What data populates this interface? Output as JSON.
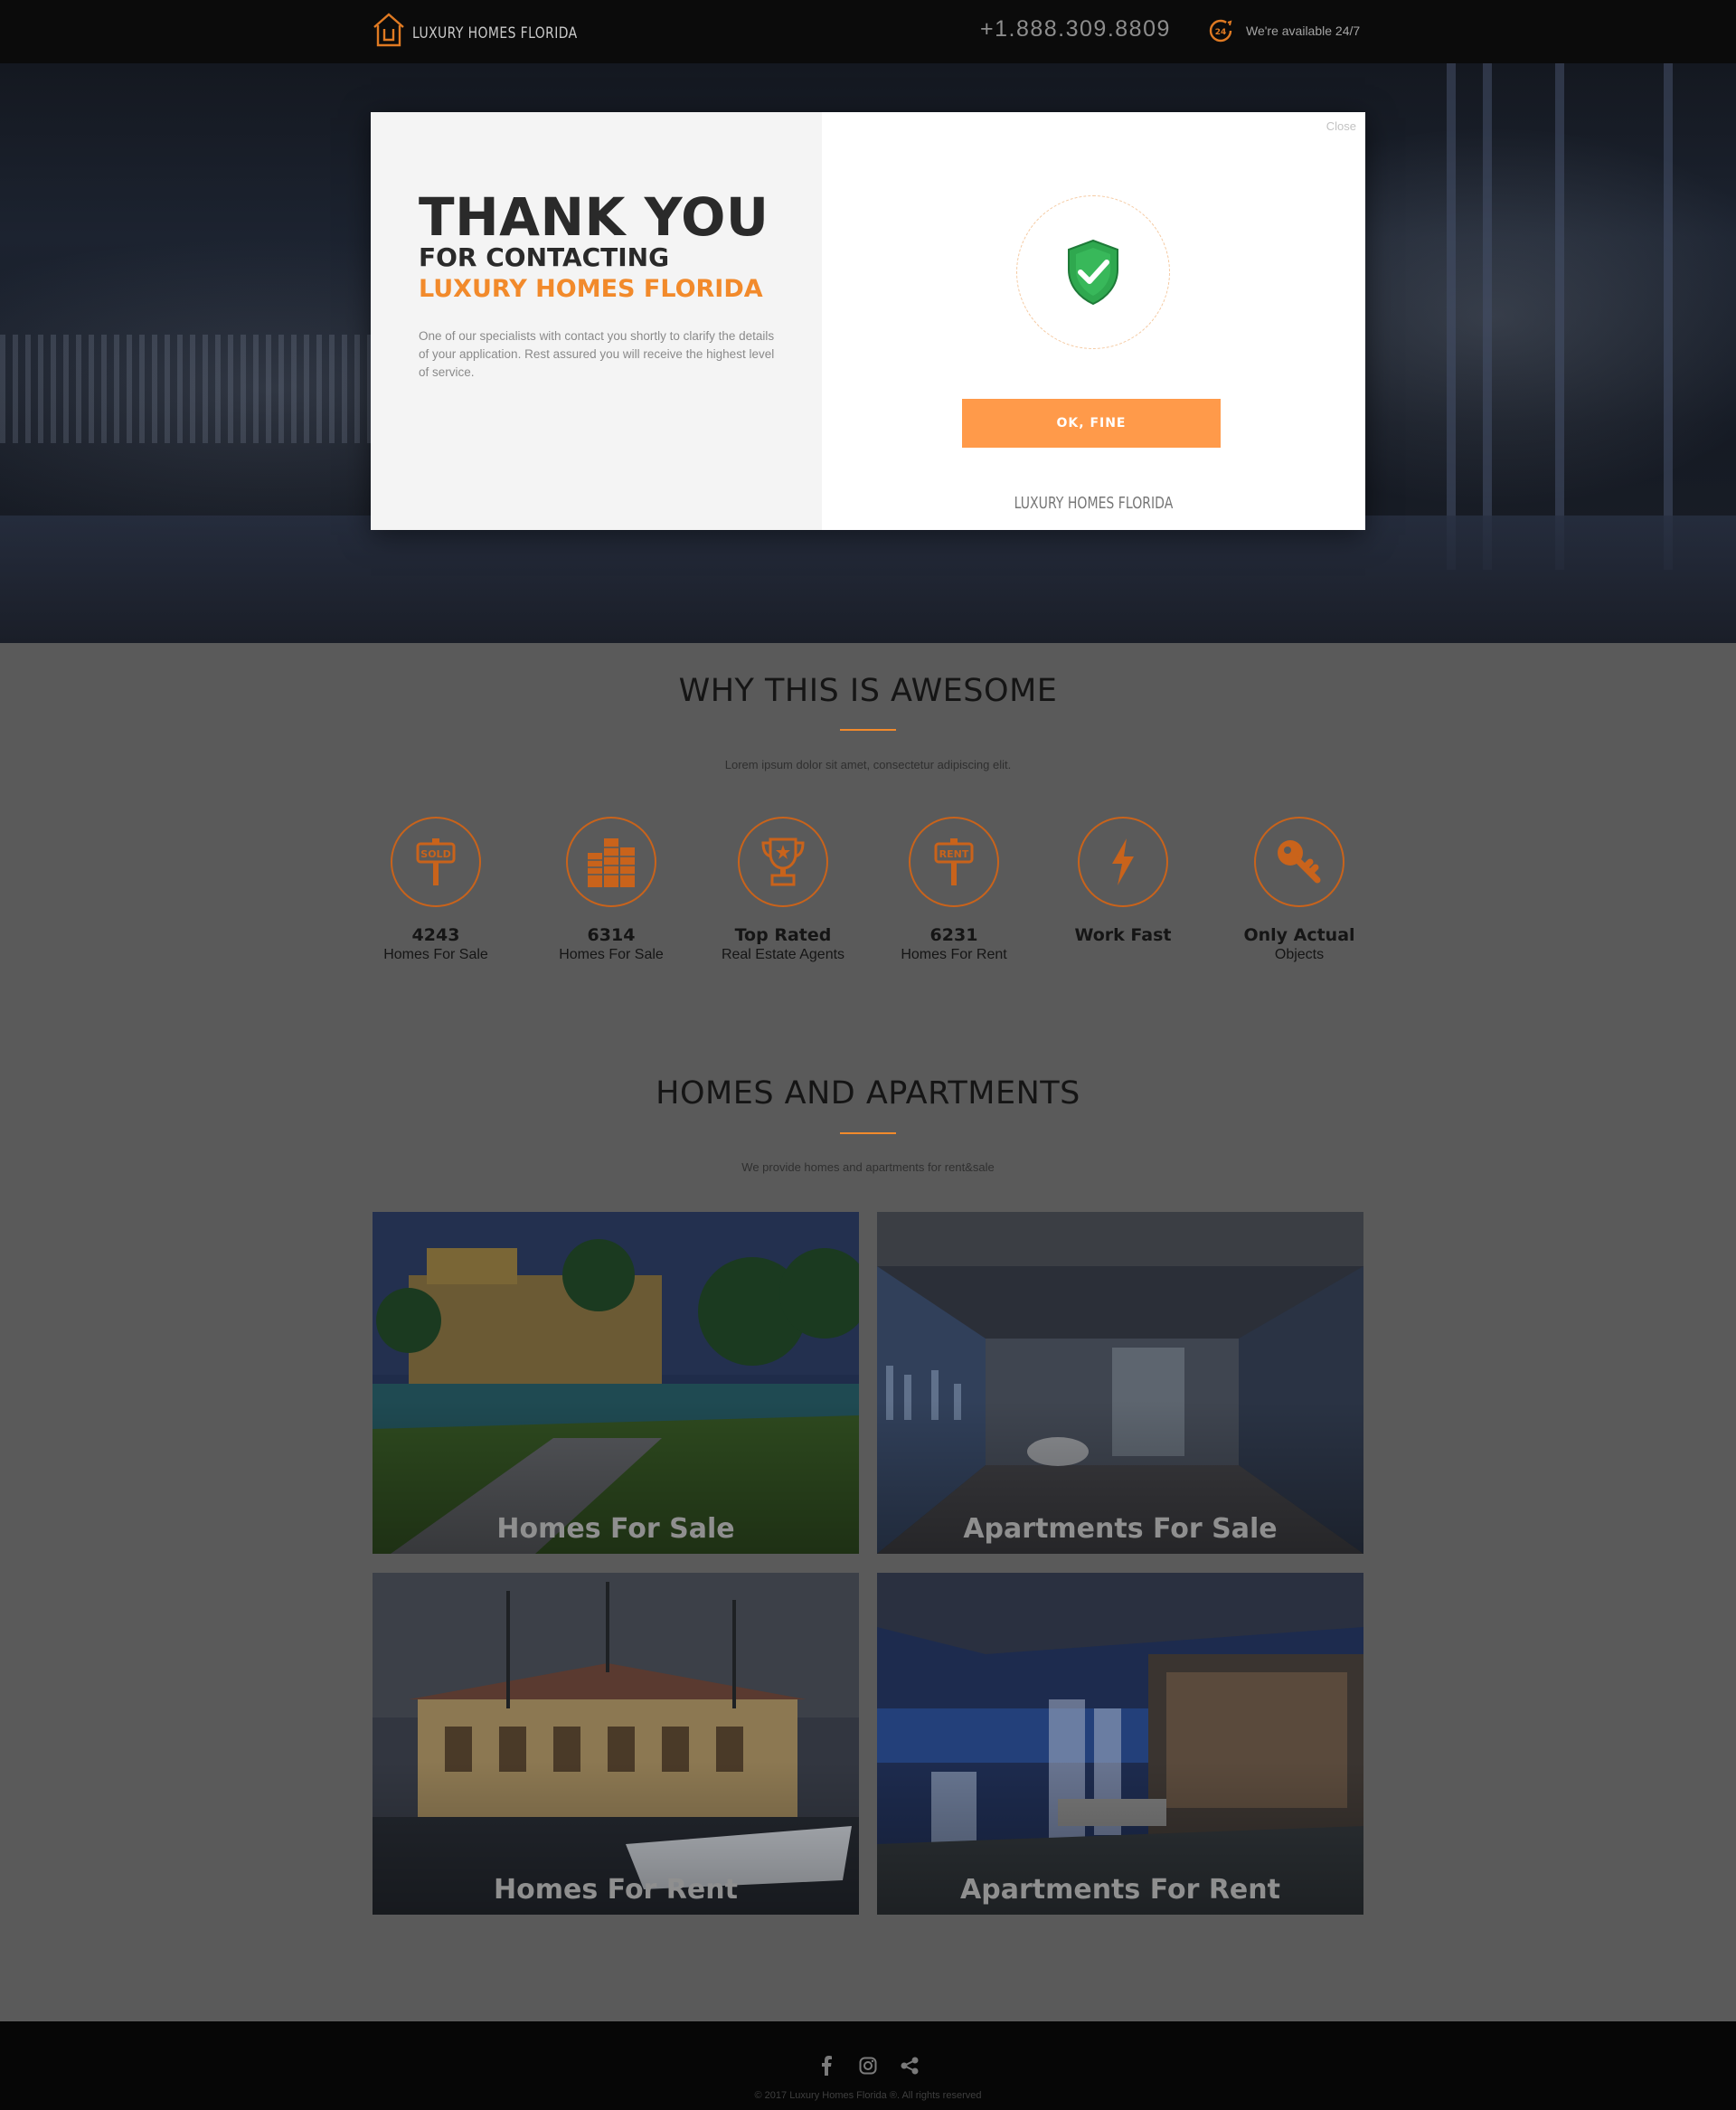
{
  "header": {
    "brand": "LUXURY HOMES FLORIDA",
    "phone": "+1.888.309.8809",
    "availability": "We're available 24/7",
    "availability_icon": "24-hour-clock-icon"
  },
  "modal": {
    "title": "THANK YOU",
    "subtitle": "FOR CONTACTING",
    "brand": "LUXURY HOMES FLORIDA",
    "text": "One of our specialists with contact you shortly to clarify the details of your application. Rest assured you will receive the highest level of service.",
    "close_label": "Close",
    "ok_label": "OK, FINE",
    "footer_brand": "LUXURY HOMES FLORIDA",
    "icon": "shield-check-icon"
  },
  "why": {
    "title": "WHY THIS IS AWESOME",
    "subtitle": "Lorem ipsum dolor sit amet, consectetur adipiscing elit.",
    "features": [
      {
        "value": "4243",
        "label": "Homes For Sale",
        "icon": "sold-sign-icon"
      },
      {
        "value": "6314",
        "label": "Homes For Sale",
        "icon": "buildings-icon"
      },
      {
        "value": "Top Rated",
        "label": "Real Estate Agents",
        "icon": "trophy-icon"
      },
      {
        "value": "6231",
        "label": "Homes For Rent",
        "icon": "rent-sign-icon"
      },
      {
        "value": "Work Fast",
        "label": "",
        "icon": "lightning-icon"
      },
      {
        "value": "Only Actual",
        "label": "Objects",
        "icon": "key-icon"
      }
    ]
  },
  "homes": {
    "title": "HOMES AND APARTMENTS",
    "subtitle": "We provide homes and apartments for rent&sale",
    "tiles": [
      {
        "label": "Homes For Sale"
      },
      {
        "label": "Apartments For Sale"
      },
      {
        "label": "Homes For Rent"
      },
      {
        "label": "Apartments For Rent"
      }
    ]
  },
  "footer": {
    "copyright": "© 2017  Luxury Homes Florida ®. All rights reserved",
    "social": [
      "facebook-icon",
      "instagram-icon",
      "share-icon"
    ]
  },
  "colors": {
    "accent": "#f28a2b",
    "button": "#ff9a4a",
    "shield": "#2fa84f"
  }
}
